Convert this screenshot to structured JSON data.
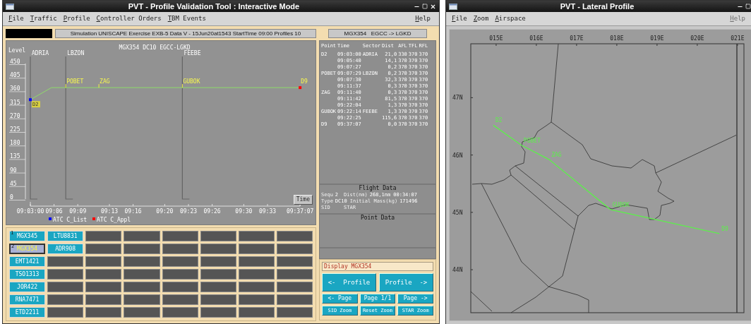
{
  "main_window": {
    "title": "PVT - Profile Validation Tool : Interactive Mode",
    "menu": [
      {
        "label": "File"
      },
      {
        "label": "Traffic"
      },
      {
        "label": "Profile"
      },
      {
        "label": "Controller Orders"
      },
      {
        "label": "TBM Events"
      }
    ],
    "help": "Help",
    "simulation_info": "Simulation UNISCAPE Exercise EXB-5 Data V - 15Jun20at1543 StartTime 09:00 Profiles 10",
    "flight_header": "MGX354   EGCC -> LGKD",
    "vertical_profile": {
      "time_button": "Time",
      "legend": [
        {
          "label": "ATC C_List",
          "color": "#0000ff"
        },
        {
          "label": "ATC C_Appl",
          "color": "#ff0000"
        }
      ],
      "chart_data": {
        "type": "line",
        "title": "MGX354   DC10 EGCC-LGKD",
        "ylabel": "Level",
        "x": [
          543,
          545.67,
          547.48,
          551.67,
          562.23,
          577.12
        ],
        "series": [
          {
            "color": "#8fdc6a",
            "values": [
              330,
              370,
              370,
              370,
              370,
              370
            ]
          }
        ],
        "value_labels": [
          "D2",
          null,
          "POBET",
          "ZAG",
          "GUBOK",
          "D9"
        ],
        "xlim": [
          543,
          577.12
        ],
        "ylim": [
          0,
          450
        ],
        "xticks": [
          {
            "value": 543,
            "label": "09:03:00"
          },
          {
            "value": 546,
            "label": "09:06"
          },
          {
            "value": 549,
            "label": "09:09"
          },
          {
            "value": 553,
            "label": "09:13"
          },
          {
            "value": 556,
            "label": "09:16"
          },
          {
            "value": 560,
            "label": "09:20"
          },
          {
            "value": 563,
            "label": "09:23"
          },
          {
            "value": 566,
            "label": "09:26"
          },
          {
            "value": 570,
            "label": "09:30"
          },
          {
            "value": 573,
            "label": "09:33"
          },
          {
            "value": 577.12,
            "label": "09:37:07"
          }
        ],
        "yticks": [
          0,
          45,
          90,
          135,
          180,
          225,
          270,
          315,
          360,
          405,
          450
        ],
        "ref_lines": [
          {
            "axis": "x",
            "value": 543,
            "label": "ADRIA"
          },
          {
            "axis": "x",
            "value": 547.48,
            "label": "LBZON"
          },
          {
            "axis": "x",
            "value": 562.23,
            "label": "FEEBE"
          }
        ]
      }
    },
    "point_table": {
      "columns": [
        "Point",
        "Time",
        "Sector",
        "Dist",
        "AFL",
        "TFL",
        "RFL"
      ],
      "rows": [
        {
          "point": "D2",
          "time": "09:03:00",
          "sector": "ADRIA",
          "dist": "21,0",
          "afl": "330",
          "tfl": "370",
          "rfl": "370"
        },
        {
          "time": "09:05:40",
          "dist": "14,1",
          "afl": "370",
          "tfl": "370",
          "rfl": "370"
        },
        {
          "time": "09:07:27",
          "dist": "0,2",
          "afl": "370",
          "tfl": "370",
          "rfl": "370"
        },
        {
          "point": "POBET",
          "time": "09:07:29",
          "sector": "LBZON",
          "dist": "0,2",
          "afl": "370",
          "tfl": "370",
          "rfl": "370"
        },
        {
          "time": "09:07:30",
          "dist": "32,3",
          "afl": "370",
          "tfl": "370",
          "rfl": "370"
        },
        {
          "time": "09:11:37",
          "dist": "0,3",
          "afl": "370",
          "tfl": "370",
          "rfl": "370"
        },
        {
          "point": "ZAG",
          "time": "09:11:40",
          "dist": "0,3",
          "afl": "370",
          "tfl": "370",
          "rfl": "370"
        },
        {
          "time": "09:11:42",
          "dist": "81,5",
          "afl": "370",
          "tfl": "370",
          "rfl": "370"
        },
        {
          "time": "09:22:04",
          "dist": "1,3",
          "afl": "370",
          "tfl": "370",
          "rfl": "370"
        },
        {
          "point": "GUBOK",
          "time": "09:22:14",
          "sector": "FEEBE",
          "dist": "1,3",
          "afl": "370",
          "tfl": "370",
          "rfl": "370"
        },
        {
          "time": "09:22:25",
          "dist": "115,6",
          "afl": "370",
          "tfl": "370",
          "rfl": "370"
        },
        {
          "point": "D9",
          "time": "09:37:07",
          "dist": "0,0",
          "afl": "370",
          "tfl": "370",
          "rfl": "370"
        }
      ]
    },
    "flight_data": {
      "title": "Flight Data",
      "rows": [
        [
          {
            "label": "Sequ",
            "value": "2"
          },
          {
            "label": "Dist(nm)",
            "value": "268,1nm"
          },
          {
            "value": "00:34:07"
          }
        ],
        [
          {
            "label": "Type",
            "value": "DC10"
          },
          {
            "label": "Initial Mass(kg)",
            "value": "171496"
          }
        ],
        [
          {
            "label": "SID"
          },
          {
            "label": "STAR"
          }
        ]
      ]
    },
    "point_data": {
      "title": "Point Data"
    },
    "flight_grid": {
      "rows": [
        {
          "flights": [
            {
              "callsign": "MGX345",
              "index": "1",
              "selected": false
            },
            {
              "callsign": "LTU8831",
              "selected": false
            }
          ]
        },
        {
          "flights": [
            {
              "callsign": "MGX354",
              "index": "2",
              "selected": true
            },
            {
              "callsign": "ADR908",
              "selected": false
            }
          ]
        },
        {
          "flights": [
            {
              "callsign": "EMT1421",
              "selected": false
            }
          ]
        },
        {
          "flights": [
            {
              "callsign": "TSO1313",
              "selected": false
            }
          ]
        },
        {
          "flights": [
            {
              "callsign": "JOR422",
              "selected": false
            }
          ]
        },
        {
          "flights": [
            {
              "callsign": "RNA7471",
              "selected": false
            }
          ]
        },
        {
          "flights": [
            {
              "callsign": "ETD2211",
              "selected": false
            }
          ]
        }
      ]
    },
    "display_field": "Display MGX354",
    "profile_buttons": [
      "<-  Profile",
      "Profile  ->"
    ],
    "page_buttons": [
      "<- Page",
      "Page 1/1",
      "Page ->"
    ],
    "zoom_buttons": [
      "SID Zoom",
      "Reset Zoom",
      "STAR Zoom"
    ]
  },
  "lateral_window": {
    "title": "PVT - Lateral Profile",
    "menu": [
      {
        "label": "File"
      },
      {
        "label": "Zoom"
      },
      {
        "label": "Airspace"
      }
    ],
    "help": {
      "label": "Help",
      "disabled": true
    },
    "chart_data": {
      "type": "line",
      "xlim": [
        14.37,
        21.16
      ],
      "ylim": [
        43.25,
        47.94
      ],
      "xticks": [
        {
          "value": 15,
          "label": "015E"
        },
        {
          "value": 16,
          "label": "016E"
        },
        {
          "value": 17,
          "label": "017E"
        },
        {
          "value": 18,
          "label": "018E"
        },
        {
          "value": 19,
          "label": "019E"
        },
        {
          "value": 20,
          "label": "020E"
        },
        {
          "value": 21,
          "label": "021E"
        }
      ],
      "yticks": [
        {
          "value": 47,
          "label": "47N"
        },
        {
          "value": 46,
          "label": "46N"
        },
        {
          "value": 45,
          "label": "45N"
        },
        {
          "value": 44,
          "label": "44N"
        }
      ],
      "x": [
        14.93,
        15.63,
        16.32,
        17.84,
        20.55
      ],
      "series": [
        {
          "color": "#5cf04a",
          "values": [
            46.52,
            46.17,
            45.92,
            45.05,
            44.63
          ]
        }
      ],
      "value_labels": [
        "D2",
        "POBET",
        "ZAG",
        "GUBOK",
        "D9"
      ]
    }
  }
}
